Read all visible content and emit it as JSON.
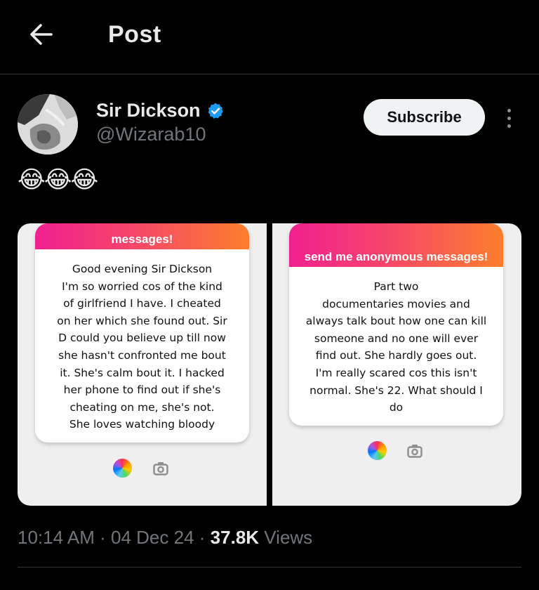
{
  "header": {
    "title": "Post",
    "back_icon": "arrow-left-icon"
  },
  "author": {
    "name": "Sir Dickson",
    "handle": "@Wizarab10",
    "verified": true,
    "verified_color": "#1d9bf0"
  },
  "actions": {
    "subscribe_label": "Subscribe",
    "more_icon": "more-vertical-icon"
  },
  "post": {
    "text": "😂😂😂",
    "images": [
      {
        "header_text": "messages!",
        "body_lines": [
          "Good evening Sir Dickson",
          "I'm so worried cos of the kind",
          "of girlfriend I have. I cheated",
          "on her which she found out. Sir",
          "D could you believe up till now",
          "she hasn't confronted me bout",
          "it. She's calm bout it. I hacked",
          "her phone to find out if she's",
          "cheating on me, she's not.",
          "She loves watching bloody"
        ]
      },
      {
        "header_text": "send me anonymous messages!",
        "body_lines": [
          "Part two",
          "documentaries movies and",
          "always talk bout how one can kill",
          "someone and no one will ever",
          "find out. She hardly goes out.",
          "I'm really scared cos this isn't",
          "normal. She's 22. What should I",
          "do"
        ]
      }
    ]
  },
  "meta": {
    "time": "10:14 AM",
    "separator": "·",
    "date": "04 Dec 24",
    "views_count": "37.8K",
    "views_label": "Views"
  }
}
